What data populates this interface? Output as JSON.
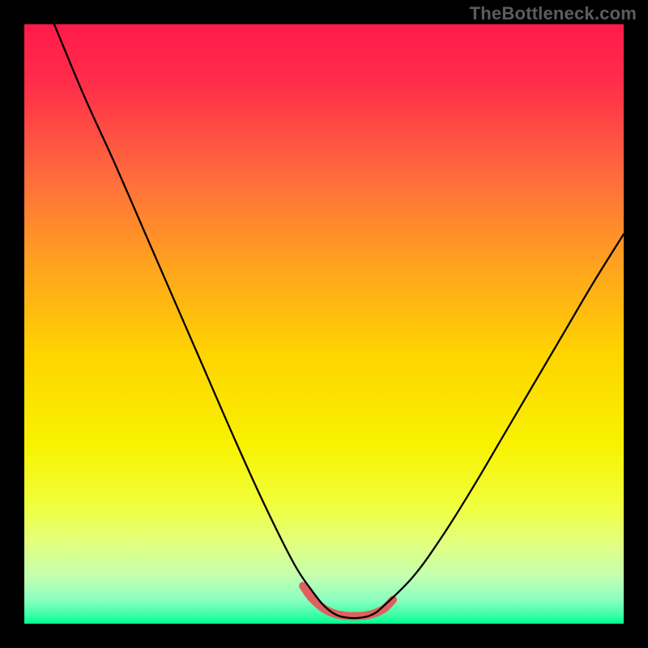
{
  "watermark": "TheBottleneck.com",
  "chart_data": {
    "type": "line",
    "title": "",
    "xlabel": "",
    "ylabel": "",
    "xlim": [
      0,
      100
    ],
    "ylim": [
      0,
      100
    ],
    "grid": false,
    "legend": false,
    "gradient_stops": [
      {
        "offset": 0.0,
        "color": "#ff1a4b"
      },
      {
        "offset": 0.1,
        "color": "#ff2e4a"
      },
      {
        "offset": 0.25,
        "color": "#ff6a3d"
      },
      {
        "offset": 0.4,
        "color": "#ffa21f"
      },
      {
        "offset": 0.55,
        "color": "#ffd400"
      },
      {
        "offset": 0.7,
        "color": "#f8f200"
      },
      {
        "offset": 0.8,
        "color": "#f0ff3a"
      },
      {
        "offset": 0.86,
        "color": "#e4ff7a"
      },
      {
        "offset": 0.92,
        "color": "#c4ffb0"
      },
      {
        "offset": 0.96,
        "color": "#8affc0"
      },
      {
        "offset": 0.985,
        "color": "#3effa7"
      },
      {
        "offset": 1.0,
        "color": "#00ff8e"
      }
    ],
    "series": [
      {
        "name": "bottleneck-curve",
        "color": "#000000",
        "width": 2.3,
        "x": [
          5,
          10,
          15,
          20,
          25,
          30,
          35,
          40,
          45,
          48,
          50,
          52,
          54,
          56,
          58,
          60,
          65,
          70,
          75,
          80,
          85,
          90,
          95,
          100
        ],
        "y": [
          100,
          88,
          77,
          65.5,
          54,
          42.5,
          31,
          20,
          10,
          5.5,
          3,
          1.5,
          1,
          1,
          1.5,
          3,
          8,
          15,
          23,
          31.5,
          40,
          48.5,
          57,
          65
        ]
      },
      {
        "name": "optimal-band",
        "color": "#e06060",
        "width": 10,
        "linecap": "round",
        "x": [
          46.5,
          48,
          50,
          52,
          54,
          56,
          58,
          60,
          61.5
        ],
        "y": [
          6.3,
          4.2,
          2.5,
          1.6,
          1.3,
          1.3,
          1.6,
          2.5,
          4.0
        ]
      }
    ]
  }
}
